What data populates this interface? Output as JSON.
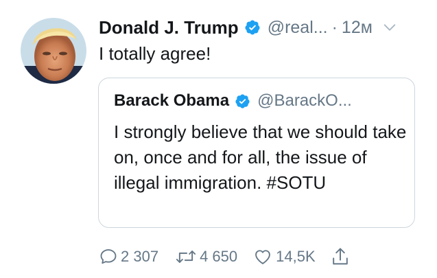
{
  "tweet": {
    "author_name": "Donald J. Trump",
    "handle": "@real...",
    "separator": "·",
    "time": "12м",
    "text": "I totally agree!"
  },
  "quoted": {
    "author_name": "Barack Obama",
    "handle": "@BarackO...",
    "text": "I strongly believe that we should take on, once and for all, the issue of illegal immigration. #SOTU"
  },
  "actions": {
    "reply_count": "2 307",
    "retweet_count": "4 650",
    "like_count": "14,5K"
  },
  "colors": {
    "verified_blue": "#1da1f2",
    "secondary_text": "#657786",
    "border": "#ccd6dd",
    "primary_text": "#14171a"
  },
  "icons": {
    "verified": "verified-badge-icon",
    "more": "chevron-down-icon",
    "reply": "speech-bubble-icon",
    "retweet": "retweet-arrows-icon",
    "like": "heart-icon",
    "share": "share-upload-icon"
  }
}
